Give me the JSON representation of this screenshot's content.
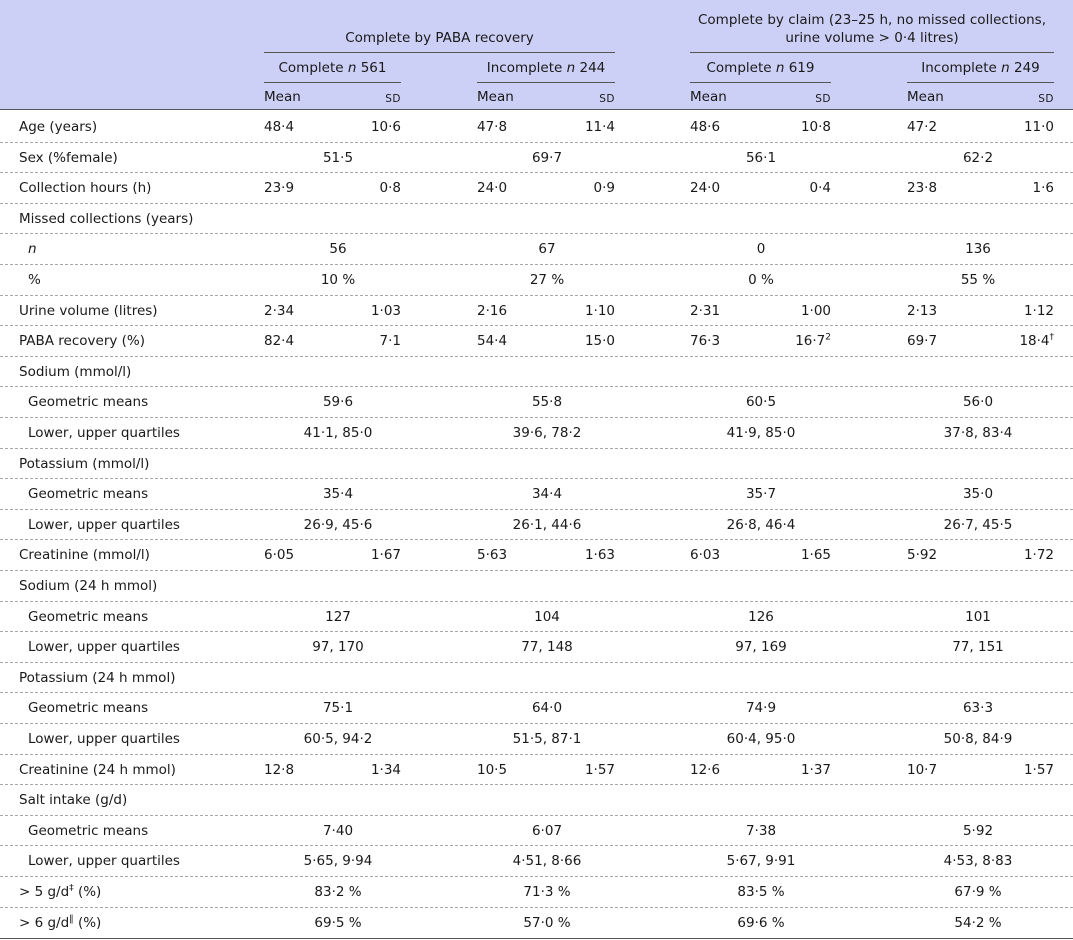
{
  "header": {
    "group1": "Complete by PABA recovery",
    "group2_line1": "Complete by claim (23–25 h, no missed collections,",
    "group2_line2": "urine volume > 0·4 litres)",
    "subgroups": [
      {
        "label": "Complete ",
        "n_symbol": "n",
        "n": "561"
      },
      {
        "label": "Incomplete ",
        "n_symbol": "n",
        "n": "244"
      },
      {
        "label": "Complete ",
        "n_symbol": "n",
        "n": "619"
      },
      {
        "label": "Incomplete ",
        "n_symbol": "n",
        "n": "249"
      }
    ],
    "mean_label": "Mean",
    "sd_label": "SD"
  },
  "rows": [
    {
      "label": "Age (years)",
      "type": "msd",
      "cells": [
        "48·4",
        "10·6",
        "47·8",
        "11·4",
        "48·6",
        "10·8",
        "47·2",
        "11·0"
      ]
    },
    {
      "label": "Sex (%female)",
      "type": "single",
      "cells": [
        "51·5",
        "69·7",
        "56·1",
        "62·2"
      ]
    },
    {
      "label": "Collection hours (h)",
      "type": "msd",
      "cells": [
        "23·9",
        "0·8",
        "24·0",
        "0·9",
        "24·0",
        "0·4",
        "23·8",
        "1·6"
      ]
    },
    {
      "label": "Missed collections (years)",
      "type": "heading"
    },
    {
      "label": "n",
      "italic": true,
      "indent": true,
      "type": "single",
      "cells": [
        "56",
        "67",
        "0",
        "136"
      ]
    },
    {
      "label": "%",
      "indent": true,
      "type": "single",
      "cells": [
        "10 %",
        "27 %",
        "0 %",
        "55 %"
      ]
    },
    {
      "label": "Urine volume (litres)",
      "type": "msd",
      "cells": [
        "2·34",
        "1·03",
        "2·16",
        "1·10",
        "2·31",
        "1·00",
        "2·13",
        "1·12"
      ]
    },
    {
      "label": "PABA recovery (%)",
      "type": "msd",
      "cells": [
        "82·4",
        "7·1",
        "54·4",
        "15·0",
        "76·3",
        "16·7",
        "69·7",
        "18·4"
      ],
      "sups": {
        "5": "2",
        "7": "†"
      }
    },
    {
      "label": "Sodium (mmol/l)",
      "type": "heading"
    },
    {
      "label": "Geometric means",
      "indent": true,
      "type": "single",
      "cells": [
        "59·6",
        "55·8",
        "60·5",
        "56·0"
      ]
    },
    {
      "label": "Lower, upper quartiles",
      "indent": true,
      "type": "single",
      "cells": [
        "41·1, 85·0",
        "39·6, 78·2",
        "41·9, 85·0",
        "37·8, 83·4"
      ]
    },
    {
      "label": "Potassium (mmol/l)",
      "type": "heading"
    },
    {
      "label": "Geometric means",
      "indent": true,
      "type": "single",
      "cells": [
        "35·4",
        "34·4",
        "35·7",
        "35·0"
      ]
    },
    {
      "label": "Lower, upper quartiles",
      "indent": true,
      "type": "single",
      "cells": [
        "26·9, 45·6",
        "26·1, 44·6",
        "26·8, 46·4",
        "26·7, 45·5"
      ]
    },
    {
      "label": "Creatinine (mmol/l)",
      "type": "msd",
      "cells": [
        "6·05",
        "1·67",
        "5·63",
        "1·63",
        "6·03",
        "1·65",
        "5·92",
        "1·72"
      ]
    },
    {
      "label": "Sodium (24 h mmol)",
      "type": "heading"
    },
    {
      "label": "Geometric means",
      "indent": true,
      "type": "single",
      "cells": [
        "127",
        "104",
        "126",
        "101"
      ]
    },
    {
      "label": "Lower, upper quartiles",
      "indent": true,
      "type": "single",
      "cells": [
        "97, 170",
        "77, 148",
        "97, 169",
        "77, 151"
      ]
    },
    {
      "label": "Potassium (24 h mmol)",
      "type": "heading"
    },
    {
      "label": "Geometric means",
      "indent": true,
      "type": "single",
      "cells": [
        "75·1",
        "64·0",
        "74·9",
        "63·3"
      ]
    },
    {
      "label": "Lower, upper quartiles",
      "indent": true,
      "type": "single",
      "cells": [
        "60·5, 94·2",
        "51·5, 87·1",
        "60·4, 95·0",
        "50·8, 84·9"
      ]
    },
    {
      "label": "Creatinine (24 h mmol)",
      "type": "msd",
      "cells": [
        "12·8",
        "1·34",
        "10·5",
        "1·57",
        "12·6",
        "1·37",
        "10·7",
        "1·57"
      ]
    },
    {
      "label": "Salt intake (g/d)",
      "type": "heading"
    },
    {
      "label": "Geometric means",
      "indent": true,
      "type": "single",
      "cells": [
        "7·40",
        "6·07",
        "7·38",
        "5·92"
      ]
    },
    {
      "label": "Lower, upper quartiles",
      "indent": true,
      "type": "single",
      "cells": [
        "5·65, 9·94",
        "4·51, 8·66",
        "5·67, 9·91",
        "4·53, 8·83"
      ]
    },
    {
      "label": "> 5 g/d",
      "label_sup": "‡",
      "label_suffix": " (%)",
      "type": "single",
      "cells": [
        "83·2 %",
        "71·3 %",
        "83·5 %",
        "67·9 %"
      ]
    },
    {
      "label": "> 6 g/d",
      "label_sup": "‖",
      "label_suffix": " (%)",
      "type": "single",
      "cells": [
        "69·5 %",
        "57·0 %",
        "69·6 %",
        "54·2 %"
      ]
    }
  ]
}
